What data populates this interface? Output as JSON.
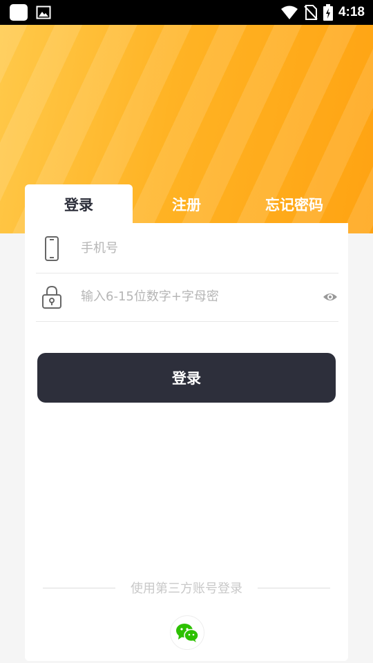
{
  "status_bar": {
    "time": "4:18"
  },
  "tabs": [
    {
      "label": "登录",
      "active": true
    },
    {
      "label": "注册",
      "active": false
    },
    {
      "label": "忘记密码",
      "active": false
    }
  ],
  "form": {
    "phone_placeholder": "手机号",
    "password_placeholder": "输入6-15位数字+字母密",
    "login_button": "登录"
  },
  "third_party": {
    "label": "使用第三方账号登录",
    "providers": [
      {
        "icon": "wechat-icon"
      }
    ]
  },
  "colors": {
    "accent_orange": "#ffb324",
    "button_dark": "#2d2f3b",
    "wechat_green": "#2dc100"
  }
}
